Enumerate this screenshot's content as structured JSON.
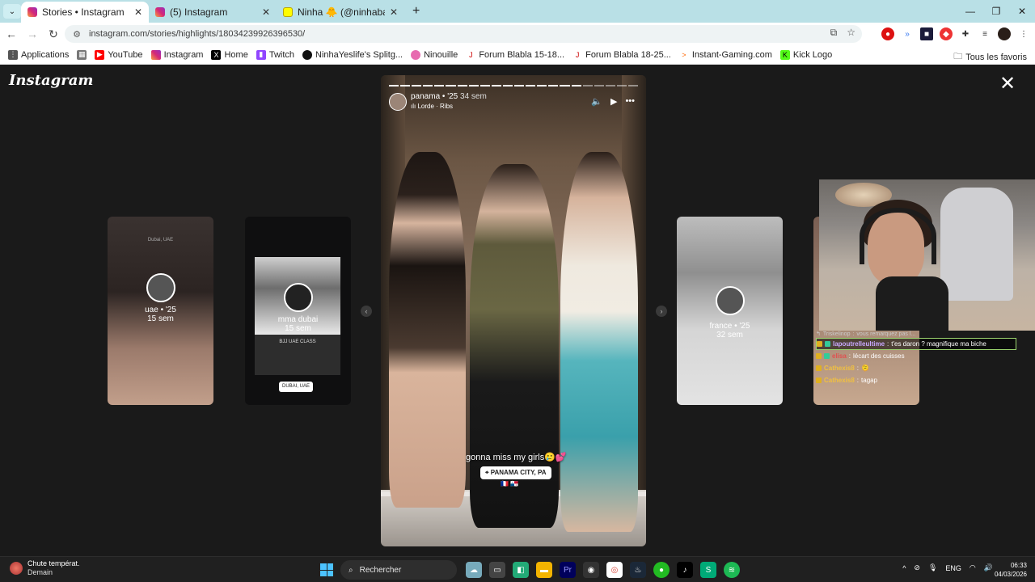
{
  "browser": {
    "tabs": [
      {
        "title": "Stories • Instagram",
        "active": true
      },
      {
        "title": "(5) Instagram",
        "active": false
      },
      {
        "title": "Ninha 🐥 (@ninhabagarre) | Sn",
        "active": false
      }
    ],
    "url": "instagram.com/stories/highlights/18034239926396530/",
    "bookmarks": [
      "Applications",
      "YouTube",
      "Instagram",
      "Home",
      "Twitch",
      "NinhaYeslife's Splitg...",
      "Ninouille",
      "Forum Blabla 15-18...",
      "Forum Blabla 18-25...",
      "Instant-Gaming.com",
      "Kick Logo"
    ],
    "all_bookmarks": "Tous les favoris"
  },
  "instagram": {
    "logo": "Instagram",
    "highlights": {
      "uae": {
        "title": "uae • '25",
        "age": "15 sem",
        "tag": "Dubai, UAE"
      },
      "dubai": {
        "title": "mma dubai",
        "age": "15 sem",
        "band": "BJJ UAE CLASS",
        "loc": "DUBAI, UAE"
      },
      "france": {
        "title": "france • '25",
        "age": "32 sem"
      }
    },
    "story": {
      "user": "panama • '25",
      "age": "34 sem",
      "music": "Lorde · Ribs",
      "caption": "gonna miss my girls🥲💕",
      "location": "PANAMA CITY, PA",
      "flags": "🇫🇷 🇵🇦"
    }
  },
  "chat": [
    {
      "user": "Triskelinop",
      "text": "vous remarquez pas l...",
      "reply": true
    },
    {
      "user": "lapoutrelleultime",
      "text": "t'es daron ? magnifique ma biche",
      "user_color": "#c9a8ff"
    },
    {
      "user": "elisa",
      "text": "lécart des cuisses",
      "user_color": "#e05050"
    },
    {
      "user": "Cathexis8",
      "text": "🫠",
      "user_color": "#f0c040"
    },
    {
      "user": "Cathexis8",
      "text": "tagap",
      "user_color": "#f0c040"
    }
  ],
  "taskbar": {
    "weather_title": "Chute températ.",
    "weather_sub": "Demain",
    "search_placeholder": "Rechercher",
    "lang": "ENG",
    "time": "06:33",
    "date": "04/03/2026"
  }
}
